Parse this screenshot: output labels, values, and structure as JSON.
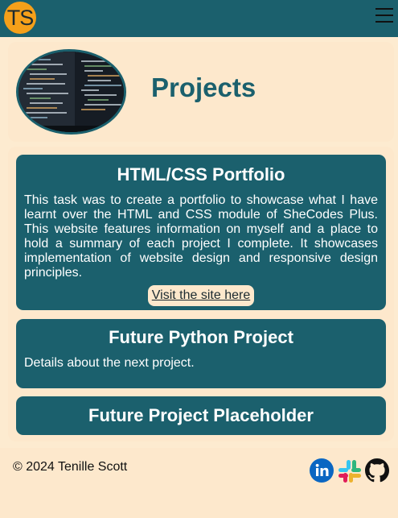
{
  "nav": {
    "logo_text": "TS",
    "menu_icon": "hamburger-icon"
  },
  "hero": {
    "title": "Projects",
    "image": "code-screen-photo"
  },
  "projects": [
    {
      "title": "HTML/CSS Portfolio",
      "description": "This task was to create a portfolio to showcase what I have learnt over the HTML and CSS module of SheCodes Plus. This website features information on myself and a place to hold a summary of each project I complete. It showcases implementation of website design and responsive design principles.",
      "link_label": "Visit the site here"
    },
    {
      "title": "Future Python Project",
      "description": "Details about the next project."
    },
    {
      "title": "Future Project Placeholder"
    }
  ],
  "footer": {
    "copyright": "© 2024 Tenille Scott",
    "social_icons": [
      "linkedin-icon",
      "slack-icon",
      "github-icon"
    ]
  },
  "colors": {
    "primary": "#1b606d",
    "background": "#fdebd0",
    "logo": "#f5a01a"
  }
}
